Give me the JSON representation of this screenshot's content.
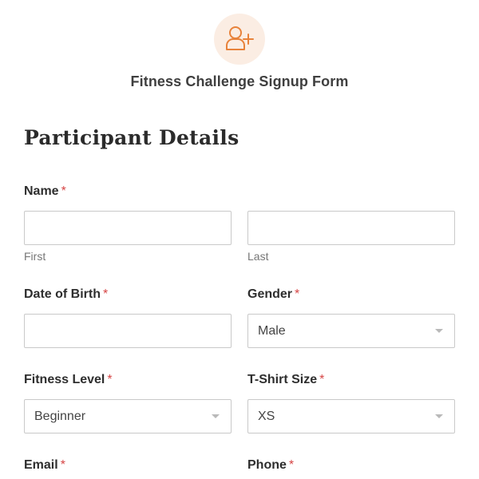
{
  "header": {
    "icon": "add-user-icon",
    "accent_color": "#e8823a",
    "icon_bg_color": "#fbede3",
    "title": "Fitness Challenge Signup Form"
  },
  "section": {
    "title": "Participant Details"
  },
  "fields": {
    "required_marker": "*",
    "name": {
      "label": "Name",
      "first_value": "",
      "last_value": "",
      "first_sublabel": "First",
      "last_sublabel": "Last"
    },
    "dob": {
      "label": "Date of Birth",
      "value": ""
    },
    "gender": {
      "label": "Gender",
      "selected": "Male"
    },
    "fitness_level": {
      "label": "Fitness Level",
      "selected": "Beginner"
    },
    "tshirt_size": {
      "label": "T-Shirt Size",
      "selected": "XS"
    },
    "email": {
      "label": "Email"
    },
    "phone": {
      "label": "Phone"
    }
  }
}
